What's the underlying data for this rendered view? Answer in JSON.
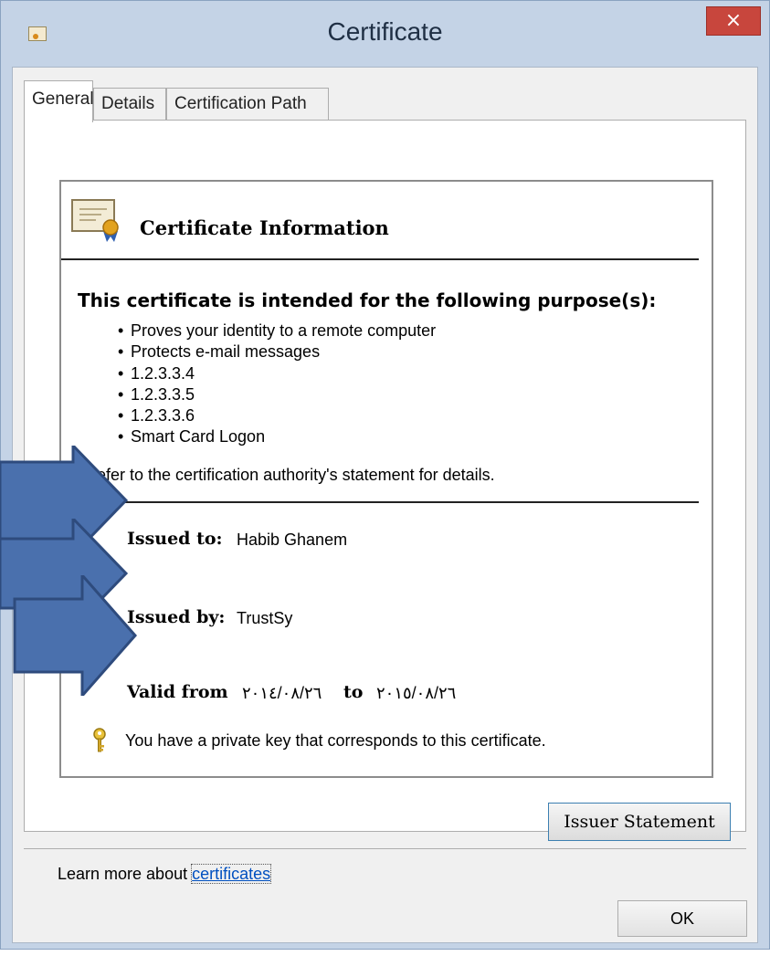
{
  "window": {
    "title": "Certificate",
    "close_glyph": "×"
  },
  "tabs": [
    {
      "label": "General",
      "active": true
    },
    {
      "label": "Details",
      "active": false
    },
    {
      "label": "Certification Path",
      "active": false
    }
  ],
  "certificate": {
    "info_title": "Certificate Information",
    "purpose_heading": "This certificate is intended for the following purpose(s):",
    "purposes": [
      "Proves your identity to a remote computer",
      "Protects e-mail messages",
      "1.2.3.3.4",
      "1.2.3.3.5",
      "1.2.3.3.6",
      "Smart Card Logon"
    ],
    "note": "* Refer to the certification authority's statement for details.",
    "issued_to_label": "Issued to:",
    "issued_to_value": "Habib Ghanem",
    "issued_by_label": "Issued by:",
    "issued_by_value": "TrustSy",
    "valid_from_label": "Valid from",
    "valid_from_value": "٢٠١٤/٠٨/٢٦",
    "valid_to_label": "to",
    "valid_to_value": "٢٠١٥/٠٨/٢٦",
    "private_key_text": "You have a private key that corresponds to this certificate."
  },
  "buttons": {
    "issuer_statement": "Issuer Statement",
    "ok": "OK"
  },
  "learn_more": {
    "prefix": "Learn more about ",
    "link": "certificates"
  },
  "colors": {
    "arrow_fill": "#4a70ad",
    "arrow_stroke": "#2e4b7d",
    "close_button": "#c8463d",
    "window_frame": "#c4d3e6"
  },
  "icons": [
    "certificate-icon",
    "key-icon",
    "close-icon",
    "app-icon",
    "arrow-annotation"
  ]
}
